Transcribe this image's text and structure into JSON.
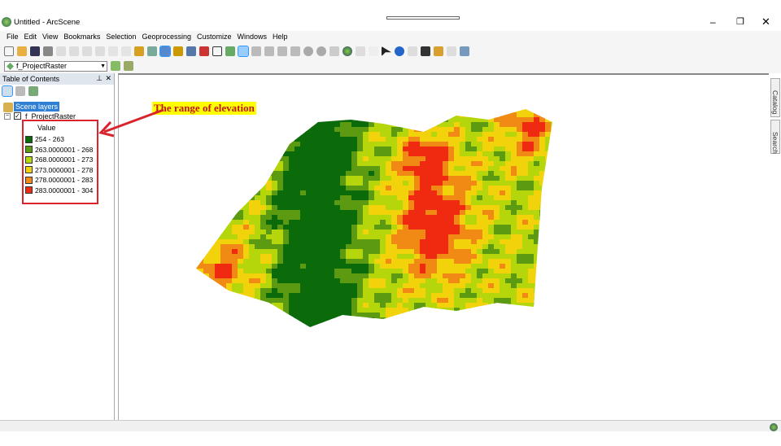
{
  "window": {
    "title": "Untitled - ArcScene"
  },
  "menu": [
    "File",
    "Edit",
    "View",
    "Bookmarks",
    "Selection",
    "Geoprocessing",
    "Customize",
    "Windows",
    "Help"
  ],
  "layer_dropdown": {
    "value": "f_ProjectRaster"
  },
  "toc": {
    "title": "Table of Contents",
    "root": "Scene layers",
    "layer": "f_ProjectRaster",
    "field": "Value",
    "classes": [
      {
        "label": "254 - 263",
        "color": "#0b6b0b"
      },
      {
        "label": "263.0000001 - 268",
        "color": "#5c9a12"
      },
      {
        "label": "268.0000001 - 273",
        "color": "#b5d60a"
      },
      {
        "label": "273.0000001 - 278",
        "color": "#f2d20a"
      },
      {
        "label": "278.0000001 - 283",
        "color": "#f08a14"
      },
      {
        "label": "283.0000001 - 304",
        "color": "#f02a10"
      }
    ]
  },
  "annotation": {
    "text": "The range of elevation",
    "color": "#d9232d",
    "text_color": "#c0161c",
    "bg": "#ffff00"
  },
  "side_tabs": [
    "Catalog",
    "Search"
  ]
}
